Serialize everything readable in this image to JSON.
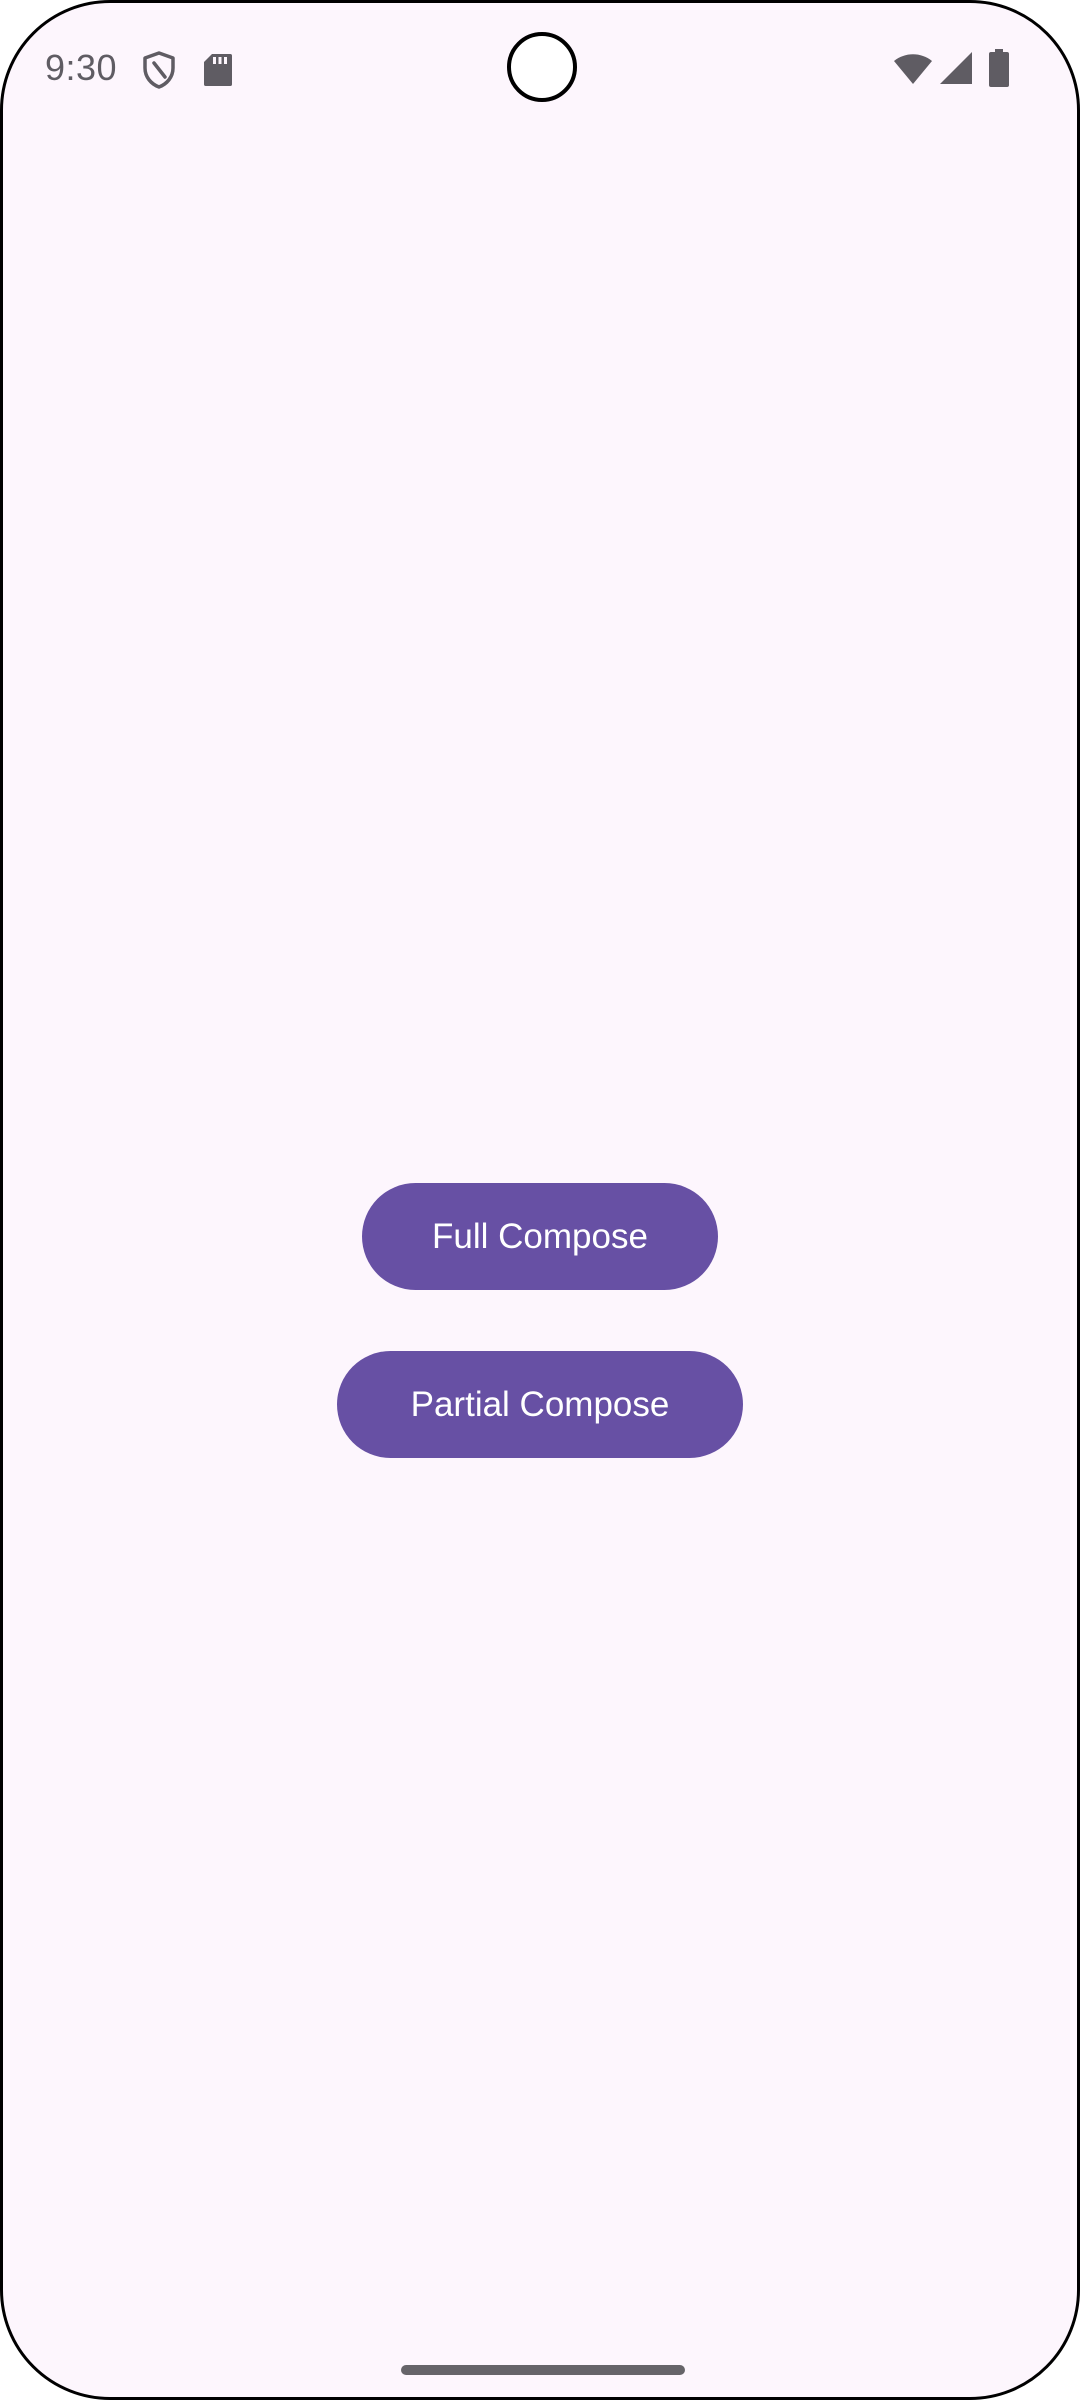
{
  "status_bar": {
    "time": "9:30",
    "left_icons": [
      "shield-icon",
      "sd-card-icon"
    ],
    "right_icons": [
      "wifi-icon",
      "cell-signal-icon",
      "battery-icon"
    ]
  },
  "main": {
    "buttons": [
      {
        "label": "Full Compose"
      },
      {
        "label": "Partial Compose"
      }
    ]
  },
  "colors": {
    "background": "#fdf6fd",
    "button": "#6750a4",
    "button_text": "#ffffff",
    "status_icons": "#5f5c63"
  }
}
